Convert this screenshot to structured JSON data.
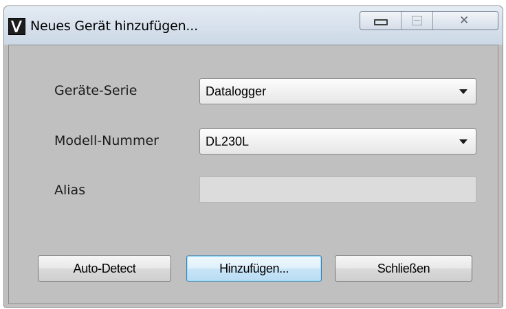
{
  "window": {
    "title": "Neues Gerät hinzufügen...",
    "icon": "app-v-logo-icon",
    "controls": {
      "minimize": "minimize-icon",
      "maximize": "maximize-icon",
      "close": "close-icon"
    }
  },
  "form": {
    "series_label": "Geräte-Serie",
    "series_value": "Datalogger",
    "model_label": "Modell-Nummer",
    "model_value": "DL230L",
    "alias_label": "Alias",
    "alias_value": ""
  },
  "buttons": {
    "auto_detect": "Auto-Detect",
    "add": "Hinzufügen...",
    "close": "Schließen"
  },
  "colors": {
    "client_background": "#c0c0c0",
    "default_button_border": "#3c7fb1"
  }
}
